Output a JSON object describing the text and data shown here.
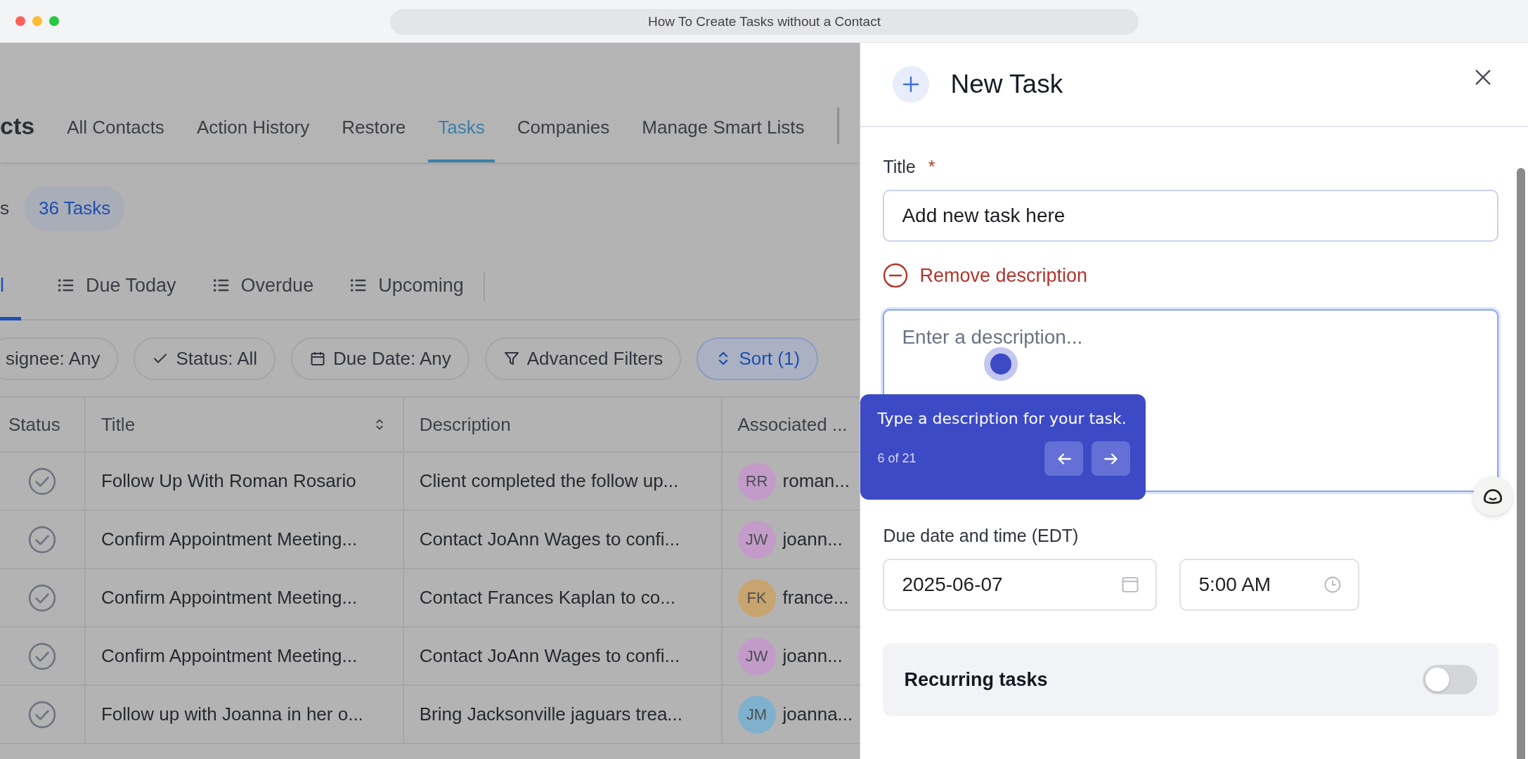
{
  "browser": {
    "title": "How To Create Tasks without a Contact"
  },
  "page": {
    "heading": "cts",
    "nav_tabs": [
      {
        "label": "All Contacts",
        "selected": false
      },
      {
        "label": "Action History",
        "selected": false
      },
      {
        "label": "Restore",
        "selected": false
      },
      {
        "label": "Tasks",
        "selected": true
      },
      {
        "label": "Companies",
        "selected": false
      },
      {
        "label": "Manage Smart Lists",
        "selected": false
      }
    ],
    "count_prefix": "s",
    "count_badge": "36 Tasks",
    "view_tabs": [
      {
        "label": "l",
        "selected": true,
        "kind": "plain"
      },
      {
        "label": "Due Today",
        "selected": false,
        "kind": "list"
      },
      {
        "label": "Overdue",
        "selected": false,
        "kind": "list"
      },
      {
        "label": "Upcoming",
        "selected": false,
        "kind": "list"
      }
    ],
    "filters": [
      {
        "label": "signee: Any",
        "kind": "plain",
        "active": false
      },
      {
        "label": "Status: All",
        "kind": "check",
        "active": false
      },
      {
        "label": "Due Date: Any",
        "kind": "calendar",
        "active": false
      },
      {
        "label": "Advanced Filters",
        "kind": "funnel",
        "active": false
      },
      {
        "label": "Sort (1)",
        "kind": "sort",
        "active": true
      }
    ]
  },
  "table": {
    "columns": [
      "Status",
      "Title",
      "Description",
      "Associated ..."
    ],
    "rows": [
      {
        "completed": true,
        "title": "Follow Up With Roman Rosario",
        "description": "Client completed the follow up...",
        "initials": "RR",
        "color": "#c39bc8",
        "contact": "roman..."
      },
      {
        "completed": true,
        "title": "Confirm Appointment Meeting...",
        "description": "Contact JoAnn Wages to confi...",
        "initials": "JW",
        "color": "#c39bc8",
        "contact": "joann..."
      },
      {
        "completed": true,
        "title": "Confirm Appointment Meeting...",
        "description": "Contact Frances Kaplan to co...",
        "initials": "FK",
        "color": "#c8a46f",
        "contact": "france..."
      },
      {
        "completed": true,
        "title": "Confirm Appointment Meeting...",
        "description": "Contact JoAnn Wages to confi...",
        "initials": "JW",
        "color": "#c39bc8",
        "contact": "joann..."
      },
      {
        "completed": true,
        "title": "Follow up with Joanna in her o...",
        "description": "Bring Jacksonville jaguars trea...",
        "initials": "JM",
        "color": "#7fb1cd",
        "contact": "joanna..."
      }
    ]
  },
  "panel": {
    "title": "New Task",
    "title_field": {
      "label": "Title",
      "required_mark": "*",
      "value": "Add new task here"
    },
    "remove_description": "Remove description",
    "description": {
      "placeholder": "Enter a description..."
    },
    "due_label": "Due date and time (EDT)",
    "date_value": "2025-06-07",
    "time_value": "5:00 AM",
    "recurring": {
      "label": "Recurring tasks",
      "on": false
    }
  },
  "tour": {
    "text": "Type a description for your task.",
    "step": "6 of 21"
  }
}
